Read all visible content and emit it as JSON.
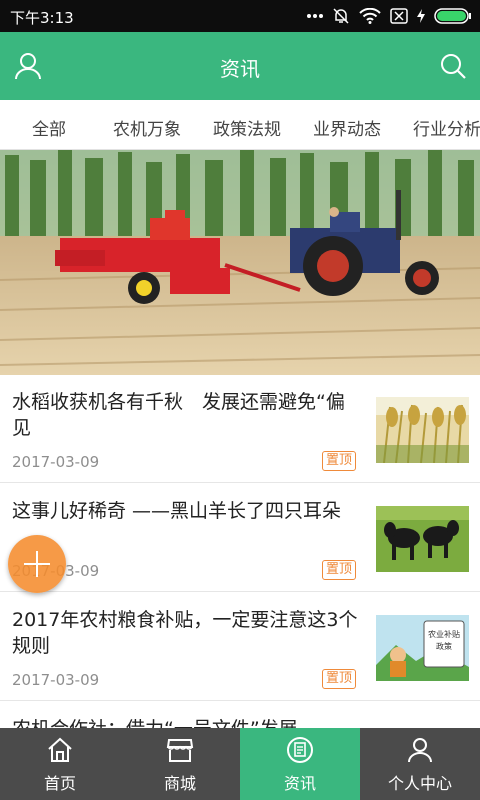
{
  "status_bar": {
    "time": "下午3:13"
  },
  "header": {
    "title": "资讯"
  },
  "tabs": [
    {
      "label": "全部"
    },
    {
      "label": "农机万象"
    },
    {
      "label": "政策法规"
    },
    {
      "label": "业界动态"
    },
    {
      "label": "行业分析"
    }
  ],
  "news": [
    {
      "title": "水稻收获机各有千秋　发展还需避免“偏见",
      "date": "2017-03-09",
      "badge": "置顶"
    },
    {
      "title": "这事儿好稀奇 ——黑山羊长了四只耳朵",
      "date": "2017-03-09",
      "badge": "置顶"
    },
    {
      "title": "2017年农村粮食补贴，一定要注意这3个规则",
      "date": "2017-03-09",
      "badge": "置顶"
    },
    {
      "title": "农机合作社：借力“一号文件”发展"
    }
  ],
  "thumb_texts": {
    "poster_line1": "农业补贴",
    "poster_line2": "政策"
  },
  "bottom_nav": [
    {
      "label": "首页",
      "icon": "home-icon"
    },
    {
      "label": "商城",
      "icon": "shop-icon"
    },
    {
      "label": "资讯",
      "icon": "news-icon"
    },
    {
      "label": "个人中心",
      "icon": "person-icon"
    }
  ],
  "colors": {
    "primary": "#3ab77f",
    "badge": "#ef8a3a",
    "fab": "#f58c2d",
    "nav_bg": "#4b4b4b"
  }
}
